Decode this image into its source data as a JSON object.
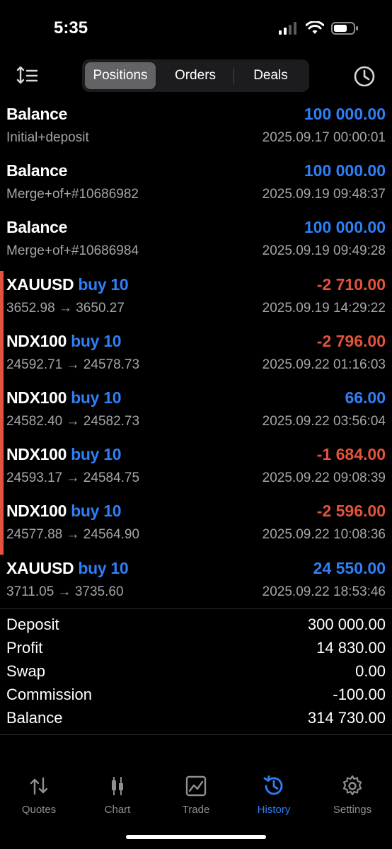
{
  "status_bar": {
    "time": "5:35"
  },
  "toolbar": {
    "tabs": [
      {
        "label": "Positions",
        "active": true
      },
      {
        "label": "Orders",
        "active": false
      },
      {
        "label": "Deals",
        "active": false
      }
    ],
    "left_icon": "sort-icon",
    "right_icon": "clock-icon"
  },
  "history": [
    {
      "title": "Balance",
      "direction": "",
      "subtitle": "Initial+deposit",
      "amount": "100 000.00",
      "date": "2025.09.17 00:00:01",
      "sign": "pos",
      "marker": false
    },
    {
      "title": "Balance",
      "direction": "",
      "subtitle": "Merge+of+#10686982",
      "amount": "100 000.00",
      "date": "2025.09.19 09:48:37",
      "sign": "pos",
      "marker": false
    },
    {
      "title": "Balance",
      "direction": "",
      "subtitle": "Merge+of+#10686984",
      "amount": "100 000.00",
      "date": "2025.09.19 09:49:28",
      "sign": "pos",
      "marker": false
    },
    {
      "title": "XAUUSD",
      "direction": "buy 10",
      "subtitle": "3652.98 → 3650.27",
      "amount": "-2 710.00",
      "date": "2025.09.19 14:29:22",
      "sign": "neg",
      "marker": true
    },
    {
      "title": "NDX100",
      "direction": "buy 10",
      "subtitle": "24592.71 → 24578.73",
      "amount": "-2 796.00",
      "date": "2025.09.22 01:16:03",
      "sign": "neg",
      "marker": true
    },
    {
      "title": "NDX100",
      "direction": "buy 10",
      "subtitle": "24582.40 → 24582.73",
      "amount": "66.00",
      "date": "2025.09.22 03:56:04",
      "sign": "pos",
      "marker": true
    },
    {
      "title": "NDX100",
      "direction": "buy 10",
      "subtitle": "24593.17 → 24584.75",
      "amount": "-1 684.00",
      "date": "2025.09.22 09:08:39",
      "sign": "neg",
      "marker": true
    },
    {
      "title": "NDX100",
      "direction": "buy 10",
      "subtitle": "24577.88 → 24564.90",
      "amount": "-2 596.00",
      "date": "2025.09.22 10:08:36",
      "sign": "neg",
      "marker": true
    },
    {
      "title": "XAUUSD",
      "direction": "buy 10",
      "subtitle": "3711.05 → 3735.60",
      "amount": "24 550.00",
      "date": "2025.09.22 18:53:46",
      "sign": "pos",
      "marker": false
    }
  ],
  "summary": [
    {
      "label": "Deposit",
      "value": "300 000.00"
    },
    {
      "label": "Profit",
      "value": "14 830.00"
    },
    {
      "label": "Swap",
      "value": "0.00"
    },
    {
      "label": "Commission",
      "value": "-100.00"
    },
    {
      "label": "Balance",
      "value": "314 730.00"
    }
  ],
  "tabbar": [
    {
      "label": "Quotes",
      "icon": "quotes-icon",
      "active": false
    },
    {
      "label": "Chart",
      "icon": "chart-icon",
      "active": false
    },
    {
      "label": "Trade",
      "icon": "trade-icon",
      "active": false
    },
    {
      "label": "History",
      "icon": "history-icon",
      "active": true
    },
    {
      "label": "Settings",
      "icon": "settings-icon",
      "active": false
    }
  ],
  "colors": {
    "positive": "#2f7ff7",
    "negative": "#e5533c",
    "secondary_text": "#a5a5aa"
  }
}
